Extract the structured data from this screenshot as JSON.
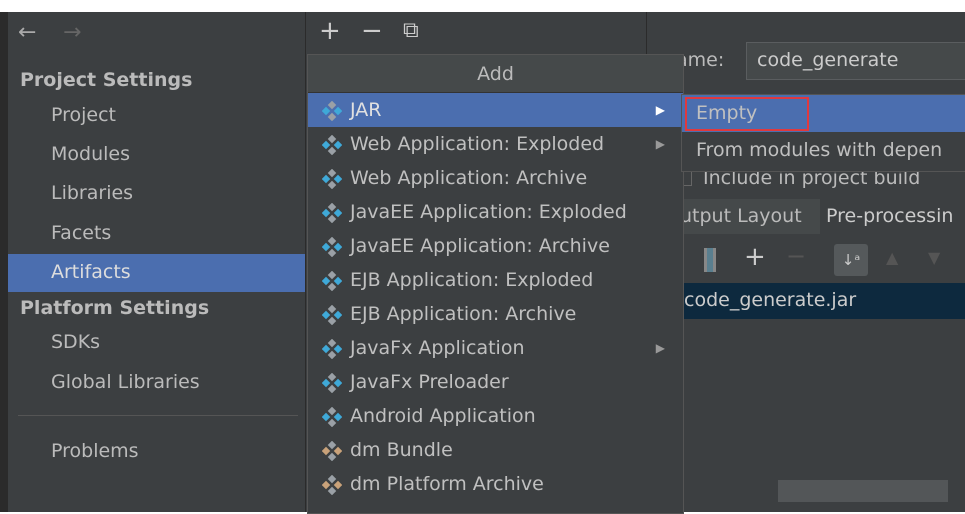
{
  "nav": {
    "back": "←",
    "forward": "→"
  },
  "sidebar": {
    "project_settings": "Project Settings",
    "project_items": [
      "Project",
      "Modules",
      "Libraries",
      "Facets",
      "Artifacts"
    ],
    "selected": "Artifacts",
    "platform_settings": "Platform Settings",
    "platform_items": [
      "SDKs",
      "Global Libraries"
    ],
    "problems": "Problems"
  },
  "toolbar": {
    "add": "+",
    "remove": "−",
    "copy": "⧉"
  },
  "add_menu": {
    "title": "Add",
    "items": [
      {
        "label": "JAR",
        "icon": "jar-icon",
        "submenu": true,
        "selected": true
      },
      {
        "label": "Web Application: Exploded",
        "icon": "web-app-icon",
        "submenu": true
      },
      {
        "label": "Web Application: Archive",
        "icon": "web-app-icon"
      },
      {
        "label": "JavaEE Application: Exploded",
        "icon": "javaee-icon"
      },
      {
        "label": "JavaEE Application: Archive",
        "icon": "javaee-icon"
      },
      {
        "label": "EJB Application: Exploded",
        "icon": "ejb-icon"
      },
      {
        "label": "EJB Application: Archive",
        "icon": "ejb-icon"
      },
      {
        "label": "JavaFx Application",
        "icon": "javafx-icon",
        "submenu": true
      },
      {
        "label": "JavaFx Preloader",
        "icon": "javafx-icon"
      },
      {
        "label": "Android Application",
        "icon": "android-icon"
      },
      {
        "label": "dm Bundle",
        "icon": "dm-bundle-icon"
      },
      {
        "label": "dm Platform Archive",
        "icon": "dm-platform-icon"
      }
    ]
  },
  "jar_submenu": {
    "items": [
      "Empty",
      "From modules with depen"
    ]
  },
  "detail": {
    "name_label": "ame:",
    "name_value": "code_generate",
    "include_build": "Include in project build",
    "tab_output": "utput Layout",
    "tab_preprocessing": "Pre-processin",
    "tree_item": "code_generate.jar"
  },
  "colors": {
    "selection": "#4b6eaf",
    "panel": "#3c3f41",
    "highlight_box": "#e0393e",
    "tree_selection": "#0d293e"
  }
}
